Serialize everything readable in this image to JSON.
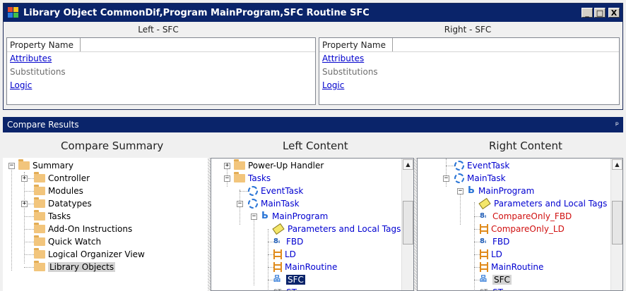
{
  "window": {
    "title": "Library Object CommonDif,Program MainProgram,SFC Routine SFC",
    "left_header": "Left - SFC",
    "right_header": "Right - SFC",
    "minimize_glyph": "_",
    "maximize_glyph": "□",
    "close_glyph": "X"
  },
  "left_props": {
    "column_header": "Property Name",
    "rows": [
      "Attributes",
      "Substitutions",
      "Logic"
    ]
  },
  "right_props": {
    "column_header": "Property Name",
    "rows": [
      "Attributes",
      "Substitutions",
      "Logic"
    ]
  },
  "results": {
    "title": "Compare Results",
    "pin_glyph": "ᵖ",
    "summary_title": "Compare Summary",
    "left_title": "Left Content",
    "right_title": "Right Content"
  },
  "summary_tree": [
    "Summary",
    "Controller",
    "Modules",
    "Datatypes",
    "Tasks",
    "Add-On Instructions",
    "Quick Watch",
    "Logical Organizer View",
    "Library Objects"
  ],
  "left_tree": [
    "Power-Up Handler",
    "Tasks",
    "EventTask",
    "MainTask",
    "MainProgram",
    "Parameters and Local Tags",
    "FBD",
    "LD",
    "MainRoutine",
    "SFC",
    "ST"
  ],
  "right_tree": [
    "EventTask",
    "MainTask",
    "MainProgram",
    "Parameters and Local Tags",
    "CompareOnly_FBD",
    "CompareOnly_LD",
    "FBD",
    "LD",
    "MainRoutine",
    "SFC",
    "ST"
  ],
  "icon_text": {
    "fbd": "8ᵢ",
    "sfc": "品",
    "st": "ST",
    "prog": "Ь"
  },
  "colors": {
    "title_bar": "#0a246a",
    "link": "#0000cc",
    "tree_blue": "#0000d0",
    "tree_red": "#d01010"
  }
}
